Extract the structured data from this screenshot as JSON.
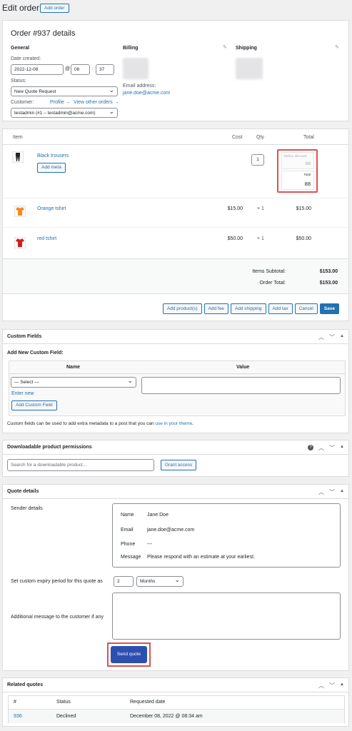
{
  "page": {
    "title": "Edit order",
    "add_order_button": "Add order"
  },
  "order_details": {
    "heading": "Order #937 details",
    "general": {
      "heading": "General",
      "date_created_label": "Date created:",
      "date": "2022-12-08",
      "at": "@",
      "hour": "08",
      "sep": ":",
      "minute": "37",
      "status_label": "Status:",
      "status_value": "New Quote Request",
      "customer_label": "Customer:",
      "profile_link": "Profile →",
      "view_orders_link": "View other orders →",
      "customer_value": "testadmin (#1 – testadmin@acme.com)"
    },
    "billing": {
      "heading": "Billing",
      "email_label": "Email address:",
      "email": "jane.doe@acme.com"
    },
    "shipping": {
      "heading": "Shipping"
    }
  },
  "items": {
    "headers": {
      "item": "Item",
      "cost": "Cost",
      "qty": "Qty",
      "total": "Total"
    },
    "rows": [
      {
        "name": "Black trousers",
        "add_meta": "Add meta",
        "qty_input": "1",
        "before_discount_label": "Before discount",
        "before_discount": "88",
        "total_label": "Total",
        "total": "88"
      },
      {
        "name": "Orange tshirt",
        "cost": "$15.00",
        "qty": "× 1",
        "total": "$15.00"
      },
      {
        "name": "red tshirt",
        "cost": "$50.00",
        "qty": "× 1",
        "total": "$50.00"
      }
    ],
    "subtotal_label": "Items Subtotal:",
    "subtotal": "$153.00",
    "order_total_label": "Order Total:",
    "order_total": "$153.00",
    "actions": {
      "add_products": "Add product(s)",
      "add_fee": "Add fee",
      "add_shipping": "Add shipping",
      "add_tax": "Add tax",
      "cancel": "Cancel",
      "save": "Save"
    }
  },
  "custom_fields": {
    "title": "Custom Fields",
    "add_new_label": "Add New Custom Field:",
    "name_header": "Name",
    "value_header": "Value",
    "select_placeholder": "— Select —",
    "enter_new": "Enter new",
    "add_button": "Add Custom Field",
    "help_prefix": "Custom fields can be used to add extra metadata to a post that you can ",
    "help_link": "use in your theme",
    "help_suffix": "."
  },
  "downloads": {
    "title": "Downloadable product permissions",
    "search_placeholder": "Search for a downloadable product…",
    "grant_button": "Grant access"
  },
  "quote": {
    "title": "Quote details",
    "sender_label": "Sender details",
    "sender": [
      {
        "label": "Name",
        "value": "Jane Doe"
      },
      {
        "label": "Email",
        "value": "jane.doe@acme.com"
      },
      {
        "label": "Phone",
        "value": "---"
      },
      {
        "label": "Message",
        "value": "Please respond with an estimate at your earliest."
      }
    ],
    "expiry_label": "Set custom expiry period for this quote as",
    "expiry_value": "2",
    "expiry_unit": "Months",
    "message_label": "Additional message to the customer if any",
    "send_button": "Send quote"
  },
  "related": {
    "title": "Related quotes",
    "headers": {
      "num": "#",
      "status": "Status",
      "date": "Requested date"
    },
    "rows": [
      {
        "num": "936",
        "status": "Declined",
        "date": "December 08, 2022 @ 08:34 am"
      }
    ]
  },
  "colors": {
    "accent": "#2271b1",
    "highlight": "#d9534f",
    "send_button": "#2c4fb0"
  },
  "icons": {
    "edit": "pencil-icon",
    "up": "chevron-up-icon",
    "down": "chevron-down-icon",
    "toggle": "triangle-up-icon",
    "help": "help-icon"
  }
}
